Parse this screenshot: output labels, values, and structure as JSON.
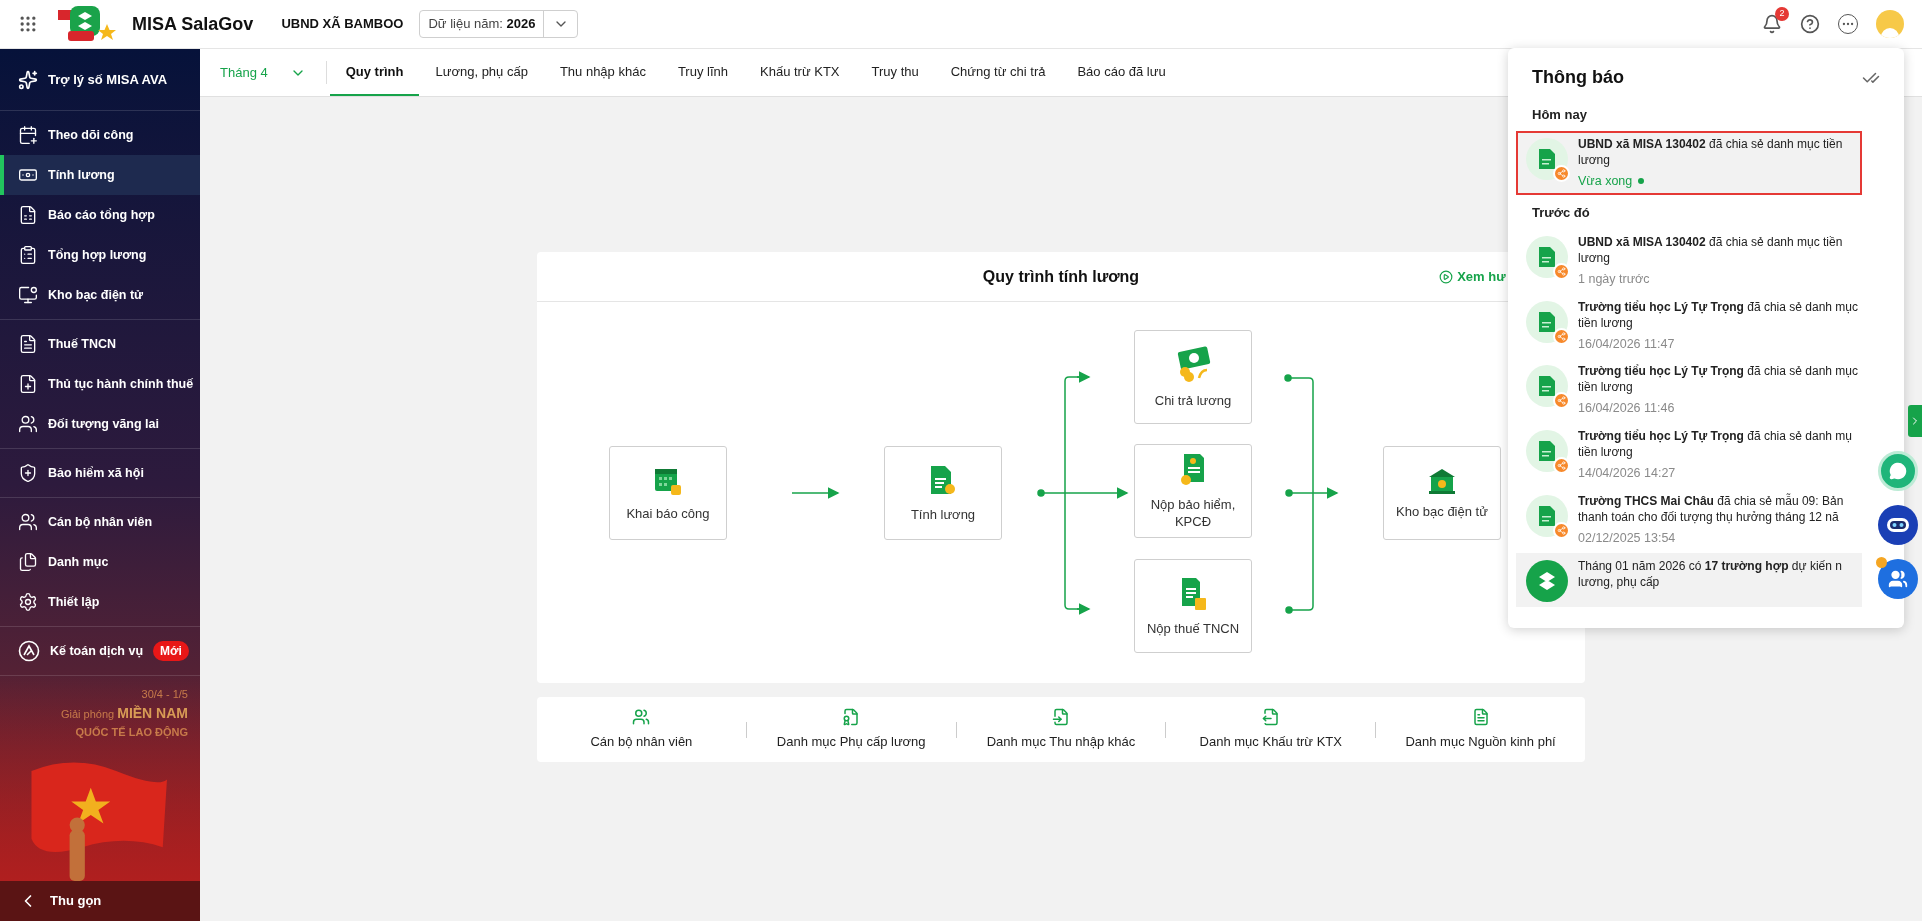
{
  "header": {
    "app_name": "MISA SalaGov",
    "unit": "UBND XÃ BAMBOO",
    "year_label": "Dữ liệu năm:",
    "year": "2026",
    "notification_count": "2"
  },
  "sidebar": {
    "assistant": "Trợ lý số MISA AVA",
    "groups": [
      [
        {
          "label": "Theo dõi công",
          "selected": false
        },
        {
          "label": "Tính lương",
          "selected": true
        },
        {
          "label": "Báo cáo tổng hợp",
          "selected": false
        },
        {
          "label": "Tổng hợp lương",
          "selected": false
        },
        {
          "label": "Kho bạc điện tử",
          "selected": false
        }
      ],
      [
        {
          "label": "Thuế TNCN",
          "selected": false
        },
        {
          "label": "Thủ tục hành chính thuế",
          "selected": false
        },
        {
          "label": "Đối tượng vãng lai",
          "selected": false
        }
      ],
      [
        {
          "label": "Bảo hiểm xã hội",
          "selected": false
        }
      ],
      [
        {
          "label": "Cán bộ nhân viên",
          "selected": false
        },
        {
          "label": "Danh mục",
          "selected": false
        },
        {
          "label": "Thiết lập",
          "selected": false
        }
      ],
      [
        {
          "label": "Kế toán dịch vụ",
          "selected": false,
          "badge": "Mới"
        }
      ]
    ],
    "banner": {
      "dates": "30/4 - 1/5",
      "line_1": "Giải phóng",
      "line_1_emphasis": "MIỀN NAM",
      "line_2": "QUỐC TẾ LAO ĐỘNG"
    },
    "collapse": "Thu gọn"
  },
  "tabs": {
    "month": "Tháng 4",
    "items": [
      {
        "label": "Quy trình",
        "selected": true
      },
      {
        "label": "Lương, phụ cấp",
        "selected": false
      },
      {
        "label": "Thu nhập khác",
        "selected": false
      },
      {
        "label": "Truy lĩnh",
        "selected": false
      },
      {
        "label": "Khấu trừ KTX",
        "selected": false
      },
      {
        "label": "Truy thu",
        "selected": false
      },
      {
        "label": "Chứng từ chi trả",
        "selected": false
      },
      {
        "label": "Báo cáo đã lưu",
        "selected": false
      }
    ]
  },
  "workflow": {
    "title": "Quy trình tính lương",
    "guide_link": "Xem hư",
    "steps": [
      "Khai báo công",
      "Tính lương",
      "Chi trả lương",
      "Nộp bảo hiểm, KPCĐ",
      "Nộp thuế TNCN",
      "Kho bạc điện tử"
    ]
  },
  "shortcuts": [
    "Cán bộ nhân viên",
    "Danh mục Phụ cấp lương",
    "Danh mục Thu nhập khác",
    "Danh mục Khấu trừ KTX",
    "Danh mục Nguồn kinh phí"
  ],
  "notifications": {
    "title": "Thông báo",
    "sections": [
      {
        "heading": "Hôm nay",
        "items": [
          {
            "kind": "share",
            "lines": [
              "**UBND xã MISA 130402** đã chia sẻ danh mục tiền",
              "lương"
            ],
            "time": "Vừa xong",
            "unread": true,
            "highlighted": true
          }
        ]
      },
      {
        "heading": "Trước đó",
        "items": [
          {
            "kind": "share",
            "lines": [
              "**UBND xã MISA 130402** đã chia sẻ danh mục tiền",
              "lương"
            ],
            "time": "1 ngày trước",
            "unread": false,
            "highlighted": false
          },
          {
            "kind": "share",
            "lines": [
              "**Trường tiểu học Lý Tự Trọng** đã chia sẻ danh mục",
              "tiền lương"
            ],
            "time": "16/04/2026 11:47",
            "unread": false,
            "highlighted": false
          },
          {
            "kind": "share",
            "lines": [
              "**Trường tiểu học Lý Tự Trọng** đã chia sẻ danh mục",
              "tiền lương"
            ],
            "time": "16/04/2026 11:46",
            "unread": false,
            "highlighted": false
          },
          {
            "kind": "share",
            "lines": [
              "**Trường tiểu học Lý Tự Trọng** đã chia sẻ danh mụ",
              "tiền lương"
            ],
            "time": "14/04/2026 14:27",
            "unread": false,
            "highlighted": false
          },
          {
            "kind": "share",
            "lines": [
              "**Trường THCS Mai Châu** đã chia sẻ mẫu 09: Bản",
              "thanh toán cho đối tượng thụ hưởng tháng 12 nă"
            ],
            "time": "02/12/2025 13:54",
            "unread": false,
            "highlighted": false
          },
          {
            "kind": "system",
            "lines": [
              "Tháng 01 năm 2026 có **17 trường hợp** dự kiến n",
              "lương, phụ cấp"
            ],
            "unread": true,
            "highlighted": false
          }
        ]
      }
    ]
  }
}
